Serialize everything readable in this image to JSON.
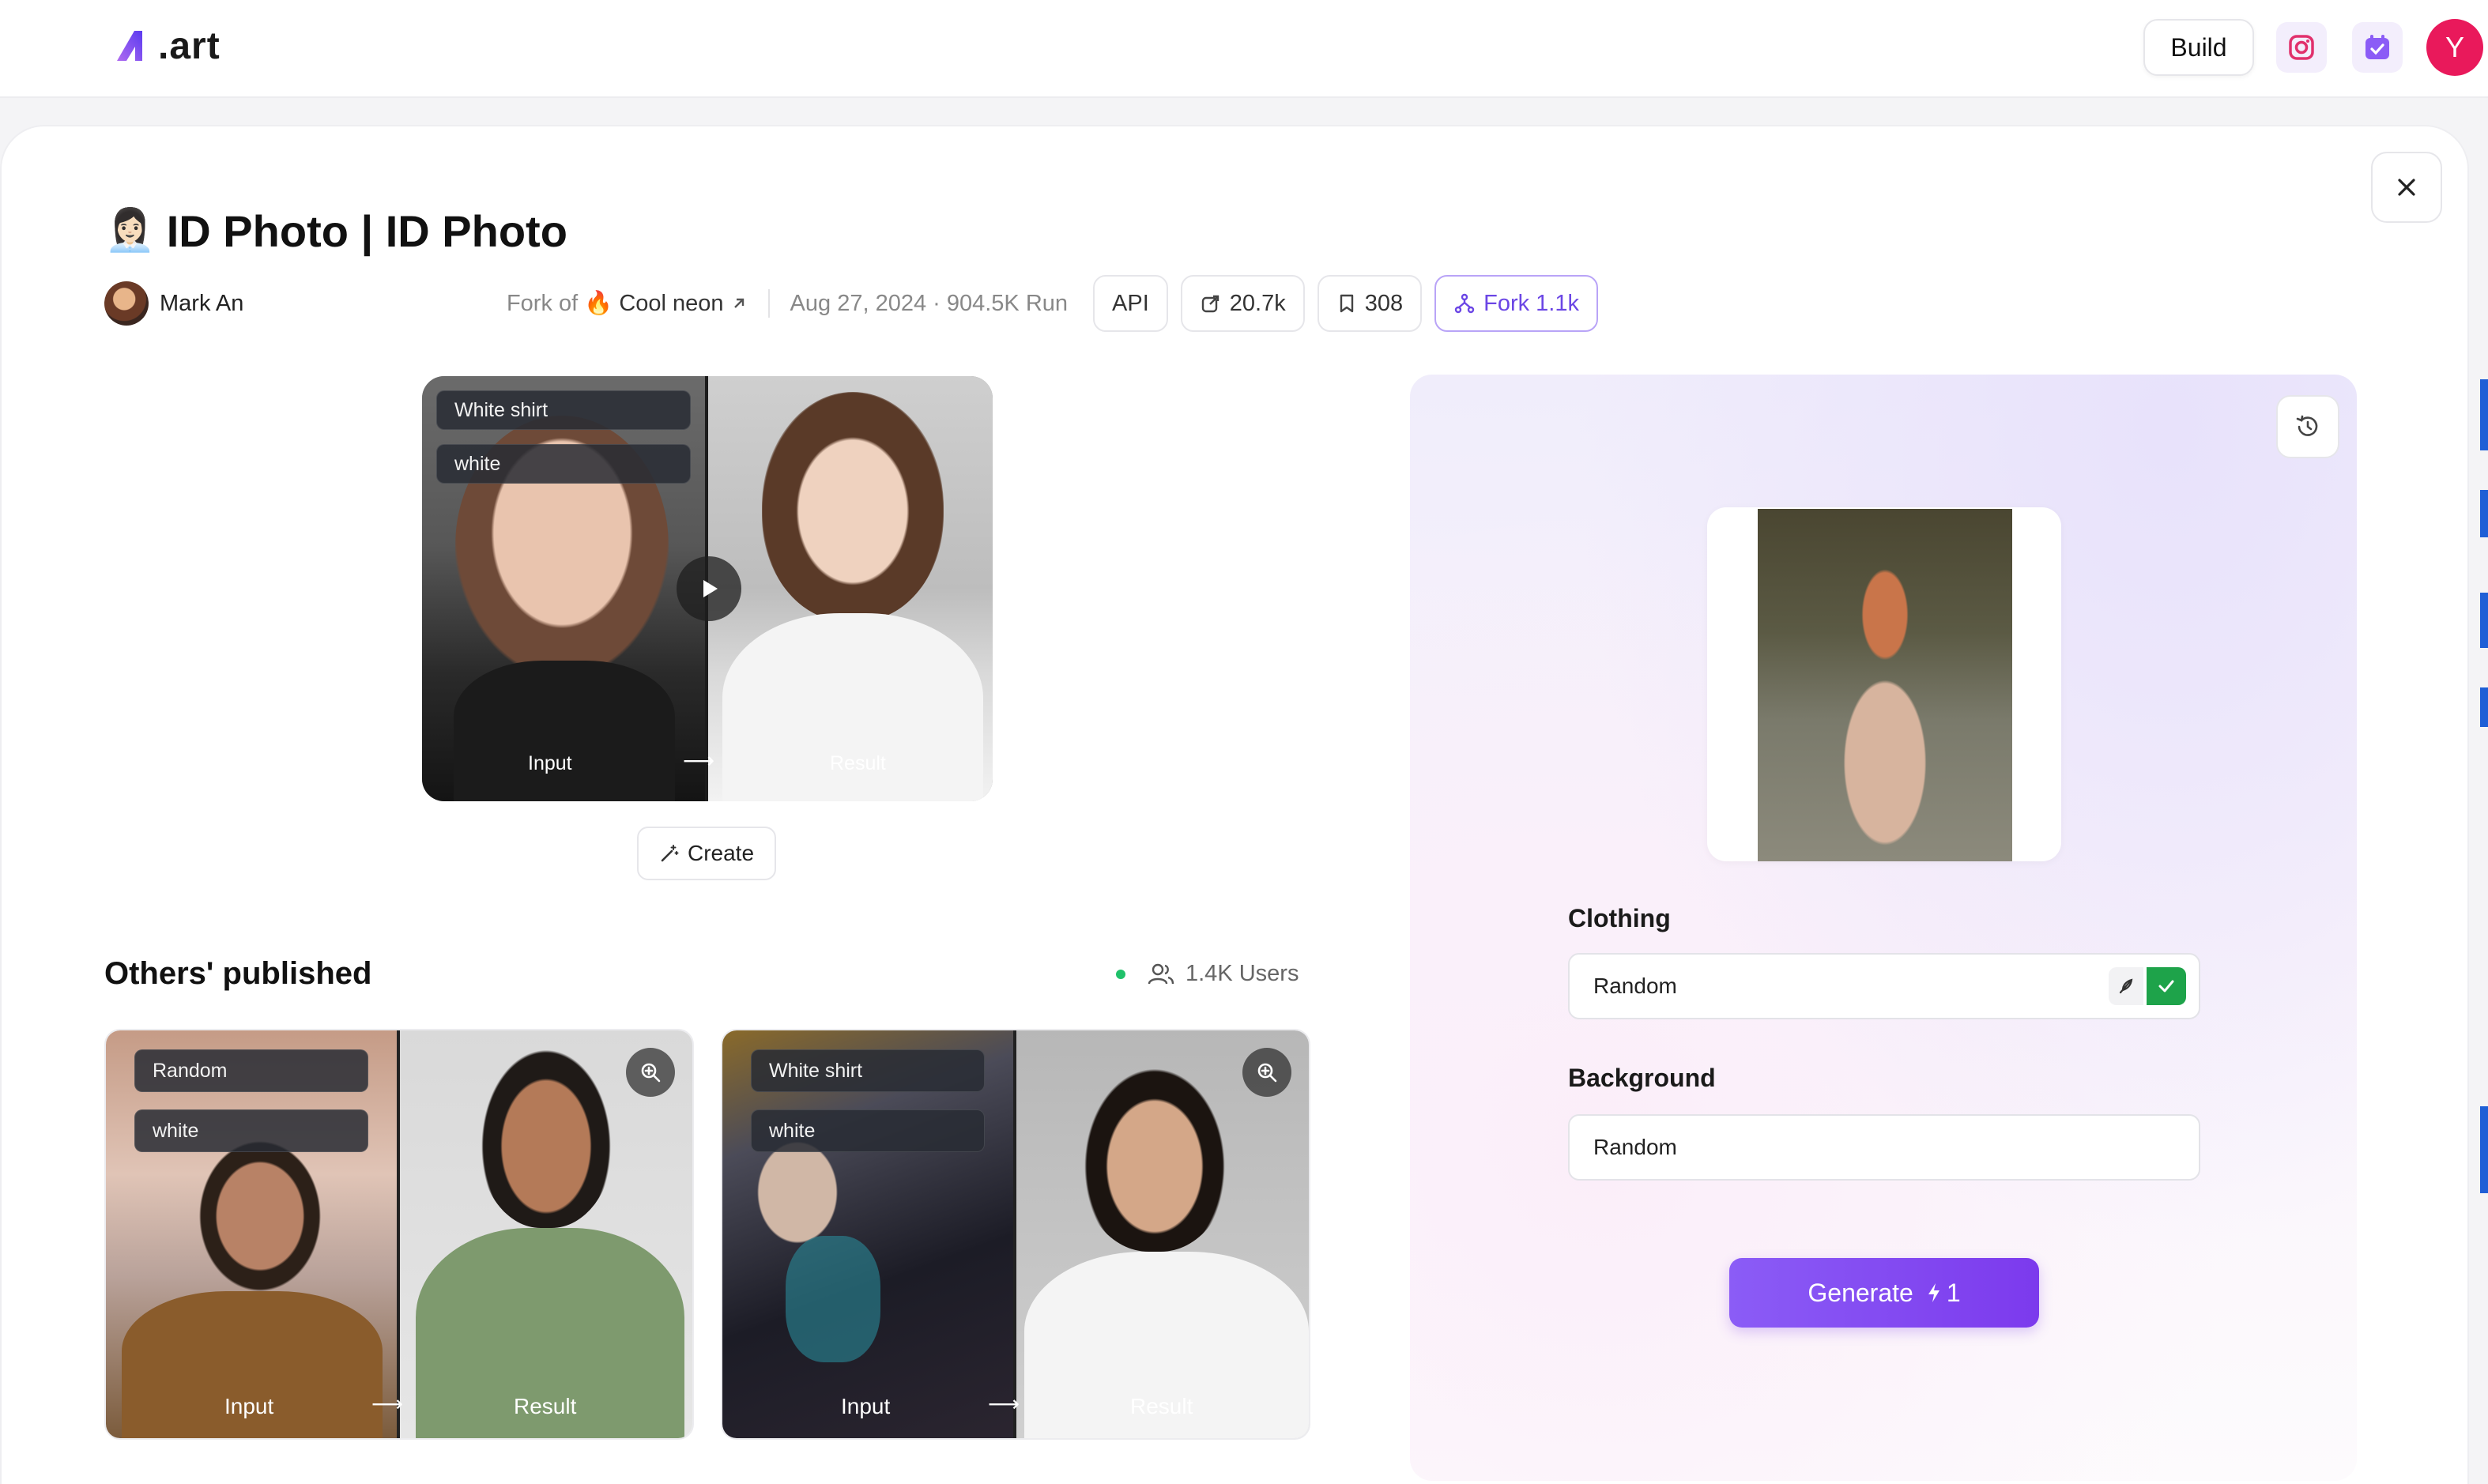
{
  "header": {
    "logo_text": ".art",
    "build_label": "Build",
    "avatar_initial": "Y",
    "accent_color": "#7c3aed",
    "avatar_color": "#e9195b"
  },
  "page": {
    "title_emoji": "👩🏻‍💼",
    "title": "ID Photo | ID Photo",
    "author_name": "Mark An",
    "fork_of_prefix": "Fork of",
    "fork_of_emoji": "🔥",
    "fork_of_name": "Cool neon",
    "date_runs": "Aug 27, 2024 · 904.5K Run",
    "api_label": "API",
    "share_count": "20.7k",
    "bookmark_count": "308",
    "fork_label": "Fork 1.1k"
  },
  "preview": {
    "tags": [
      "White shirt",
      "white"
    ],
    "input_label": "Input",
    "result_label": "Result",
    "arrow": "⟶",
    "create_label": "Create"
  },
  "others": {
    "title": "Others' published",
    "users": "1.4K Users",
    "cards": [
      {
        "tags": [
          "Random",
          "white"
        ],
        "input_label": "Input",
        "result_label": "Result"
      },
      {
        "tags": [
          "White shirt",
          "white"
        ],
        "input_label": "Input",
        "result_label": "Result"
      }
    ]
  },
  "generator": {
    "clothing_label": "Clothing",
    "clothing_value": "Random",
    "background_label": "Background",
    "background_value": "Random",
    "generate_label": "Generate",
    "generate_cost": "1"
  }
}
